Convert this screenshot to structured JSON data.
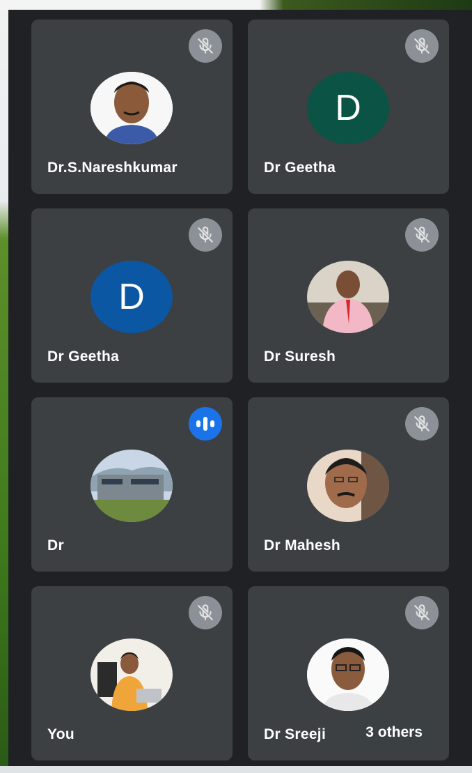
{
  "participants": [
    {
      "name": "Dr.S.Nareshkumar",
      "avatar": "photo",
      "muted": true
    },
    {
      "name": "Dr Geetha",
      "avatar_letter": "D",
      "avatar_color": "#0b5345",
      "muted": true
    },
    {
      "name": "Dr Geetha",
      "avatar_letter": "D",
      "avatar_color": "#0b57a3",
      "muted": true
    },
    {
      "name": "Dr Suresh",
      "avatar": "photo",
      "muted": true
    },
    {
      "name": "Dr",
      "avatar": "photo",
      "muted": false,
      "speaking": true
    },
    {
      "name": "Dr Mahesh",
      "avatar": "photo",
      "muted": true
    },
    {
      "name": "You",
      "avatar": "photo",
      "muted": true
    },
    {
      "name": "Dr Sreeji",
      "avatar": "photo",
      "muted": true
    }
  ],
  "overflow": {
    "label": "3 others"
  },
  "colors": {
    "tile": "#3c4043",
    "background": "#202124",
    "speaking": "#1a73e8",
    "mute_badge": "#9aa0a6"
  },
  "icons": {
    "muted": "mic-off-icon",
    "speaking": "audio-level-icon"
  }
}
